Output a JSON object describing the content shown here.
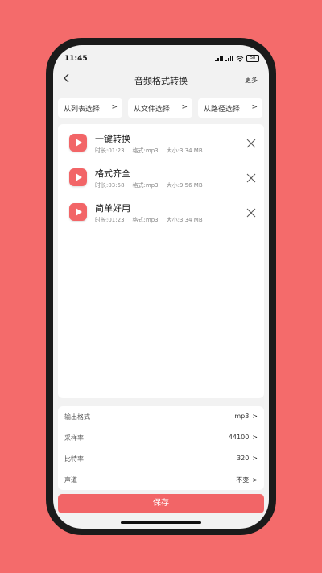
{
  "status_bar": {
    "time": "11:45",
    "battery": "58"
  },
  "header": {
    "title": "音频格式转换",
    "more_label": "更多"
  },
  "sources": [
    {
      "label": "从列表选择"
    },
    {
      "label": "从文件选择"
    },
    {
      "label": "从路径选择"
    }
  ],
  "files": [
    {
      "name": "一键转换",
      "duration": "时长:01:23",
      "format": "格式:mp3",
      "size": "大小:3.34 MB"
    },
    {
      "name": "格式齐全",
      "duration": "时长:03:58",
      "format": "格式:mp3",
      "size": "大小:9.56 MB"
    },
    {
      "name": "简单好用",
      "duration": "时长:01:23",
      "format": "格式:mp3",
      "size": "大小:3.34 MB"
    }
  ],
  "settings": [
    {
      "label": "输出格式",
      "value": "mp3"
    },
    {
      "label": "采样率",
      "value": "44100"
    },
    {
      "label": "比特率",
      "value": "320"
    },
    {
      "label": "声道",
      "value": "不变"
    }
  ],
  "save_label": "保存",
  "colors": {
    "accent": "#f26567",
    "background": "#f46b6b"
  }
}
